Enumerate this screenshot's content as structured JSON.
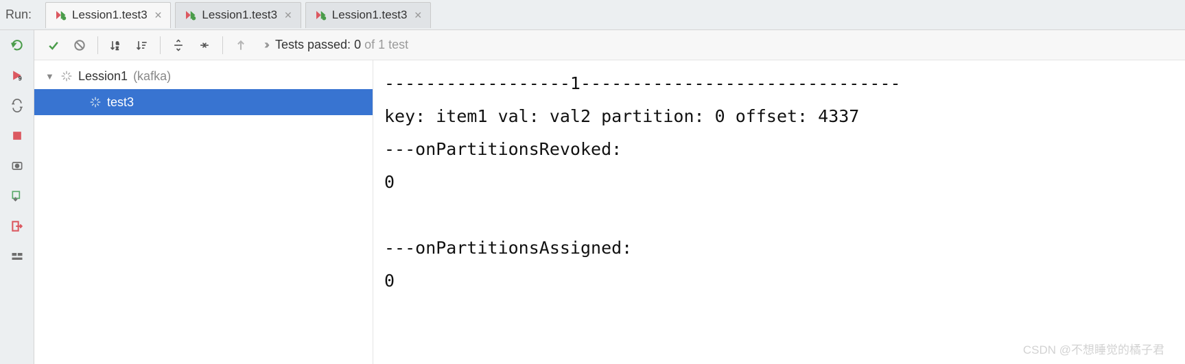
{
  "header": {
    "run_label": "Run:"
  },
  "tabs": [
    {
      "label": "Lession1.test3",
      "active": true
    },
    {
      "label": "Lession1.test3",
      "active": false
    },
    {
      "label": "Lession1.test3",
      "active": false
    }
  ],
  "toolbar": {
    "tests_passed_prefix": "Tests passed: ",
    "tests_passed_count": "0",
    "tests_passed_suffix": " of 1 test"
  },
  "tree": {
    "root_name": "Lession1",
    "root_qualifier": "(kafka)",
    "child_name": "test3"
  },
  "console_lines": [
    "------------------1-------------------------------",
    "key: item1 val: val2 partition: 0 offset: 4337",
    "---onPartitionsRevoked:",
    "0",
    "",
    "---onPartitionsAssigned:",
    "0"
  ],
  "watermark": "CSDN @不想睡觉的橘子君"
}
